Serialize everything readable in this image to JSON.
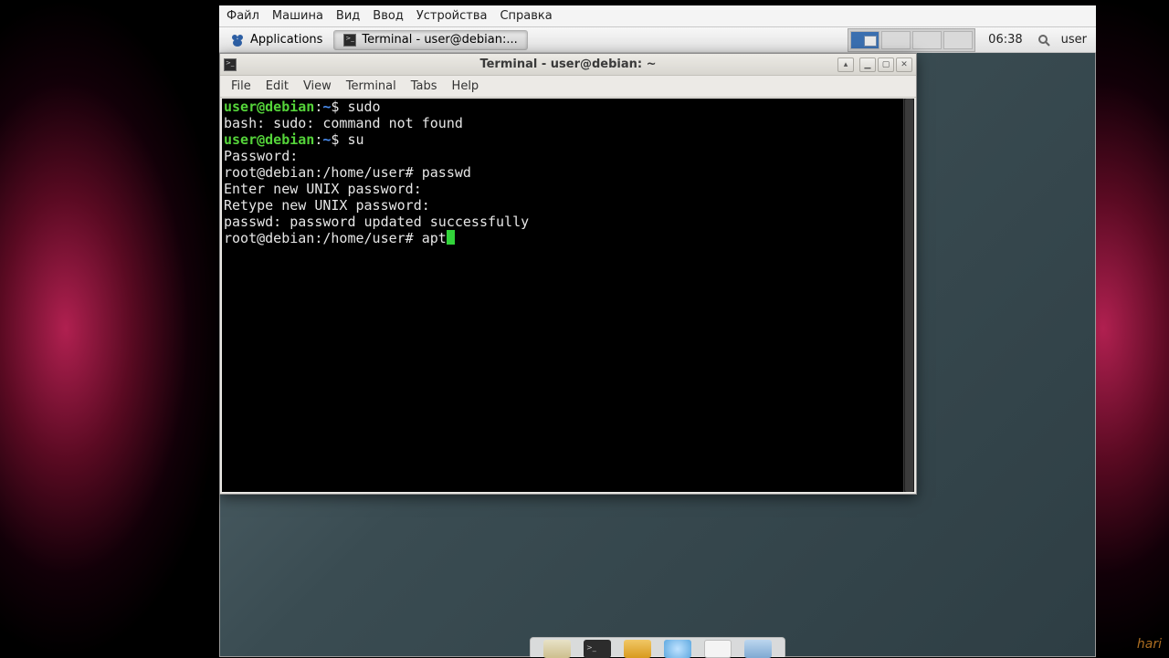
{
  "host_menu": {
    "items": [
      "Файл",
      "Машина",
      "Вид",
      "Ввод",
      "Устройства",
      "Справка"
    ]
  },
  "panel": {
    "applications_label": "Applications",
    "task_button_label": "Terminal - user@debian:...",
    "clock": "06:38",
    "user_label": "user"
  },
  "window": {
    "title": "Terminal - user@debian: ~",
    "menu": [
      "File",
      "Edit",
      "View",
      "Terminal",
      "Tabs",
      "Help"
    ],
    "buttons": {
      "pin": "▴",
      "min": "▁",
      "max": "▢",
      "close": "✕"
    }
  },
  "terminal": {
    "lines": [
      {
        "segments": [
          {
            "cls": "prompt-user",
            "text": "user@debian"
          },
          {
            "cls": "",
            "text": ":"
          },
          {
            "cls": "prompt-path",
            "text": "~"
          },
          {
            "cls": "",
            "text": "$ sudo"
          }
        ]
      },
      {
        "segments": [
          {
            "cls": "",
            "text": "bash: sudo: command not found"
          }
        ]
      },
      {
        "segments": [
          {
            "cls": "prompt-user",
            "text": "user@debian"
          },
          {
            "cls": "",
            "text": ":"
          },
          {
            "cls": "prompt-path",
            "text": "~"
          },
          {
            "cls": "",
            "text": "$ su"
          }
        ]
      },
      {
        "segments": [
          {
            "cls": "",
            "text": "Password:"
          }
        ]
      },
      {
        "segments": [
          {
            "cls": "",
            "text": "root@debian:/home/user# passwd"
          }
        ]
      },
      {
        "segments": [
          {
            "cls": "",
            "text": "Enter new UNIX password:"
          }
        ]
      },
      {
        "segments": [
          {
            "cls": "",
            "text": "Retype new UNIX password:"
          }
        ]
      },
      {
        "segments": [
          {
            "cls": "",
            "text": "passwd: password updated successfully"
          }
        ]
      },
      {
        "segments": [
          {
            "cls": "",
            "text": "root@debian:/home/user# apt"
          }
        ],
        "cursor": true
      }
    ]
  },
  "watermark": "hari"
}
